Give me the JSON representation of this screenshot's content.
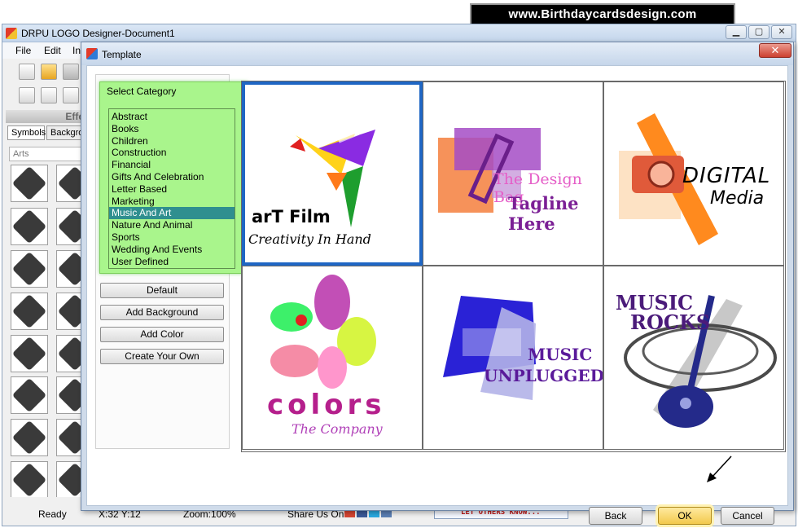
{
  "banner": {
    "text": "www.Birthdaycardsdesign.com"
  },
  "main_window": {
    "title": "DRPU LOGO Designer-Document1",
    "controls": {
      "minimize": "▁",
      "maximize": "▢",
      "close": "✕"
    },
    "menu": [
      "File",
      "Edit",
      "In"
    ],
    "effects_label": "Effe",
    "tabs": [
      "Symbols",
      "Backgro"
    ],
    "symbol_filter": "Arts"
  },
  "status_bar": {
    "ready": "Ready",
    "coords": "X:32  Y:12",
    "zoom": "Zoom:100%",
    "share": "Share Us On:",
    "ad": "LET OTHERS KNOW..."
  },
  "dialog": {
    "title": "Template",
    "close": "✕",
    "category_group_label": "Select Category",
    "categories": [
      "Abstract",
      "Books",
      "Children",
      "Construction",
      "Financial",
      "Gifts And Celebration",
      "Letter Based",
      "Marketing",
      "Music And Art",
      "Nature And Animal",
      "Sports",
      "Wedding And Events",
      "User Defined"
    ],
    "selected_category": "Music And Art",
    "buttons": {
      "default": "Default",
      "add_background": "Add Background",
      "add_color": "Add Color",
      "create_your_own": "Create Your Own"
    },
    "templates": [
      {
        "line1": "arT Film",
        "line2": "Creativity In Hand"
      },
      {
        "line1": "The Design Bag",
        "line2": "Tagline Here"
      },
      {
        "line1": "DIGITAL",
        "line2": "Media"
      },
      {
        "line1": "colors",
        "line2": "The Company"
      },
      {
        "line1": "MUSIC",
        "line2": "UNPLUGGED"
      },
      {
        "line1": "MUSIC",
        "line2": "ROCKS"
      }
    ],
    "footer": {
      "back": "Back",
      "ok": "OK",
      "cancel": "Cancel"
    }
  },
  "colors": {
    "category_bg": "#a9f58c",
    "selection": "#2f8f8f",
    "selected_border": "#1f66c4",
    "ok_button": "#f2c94c"
  }
}
